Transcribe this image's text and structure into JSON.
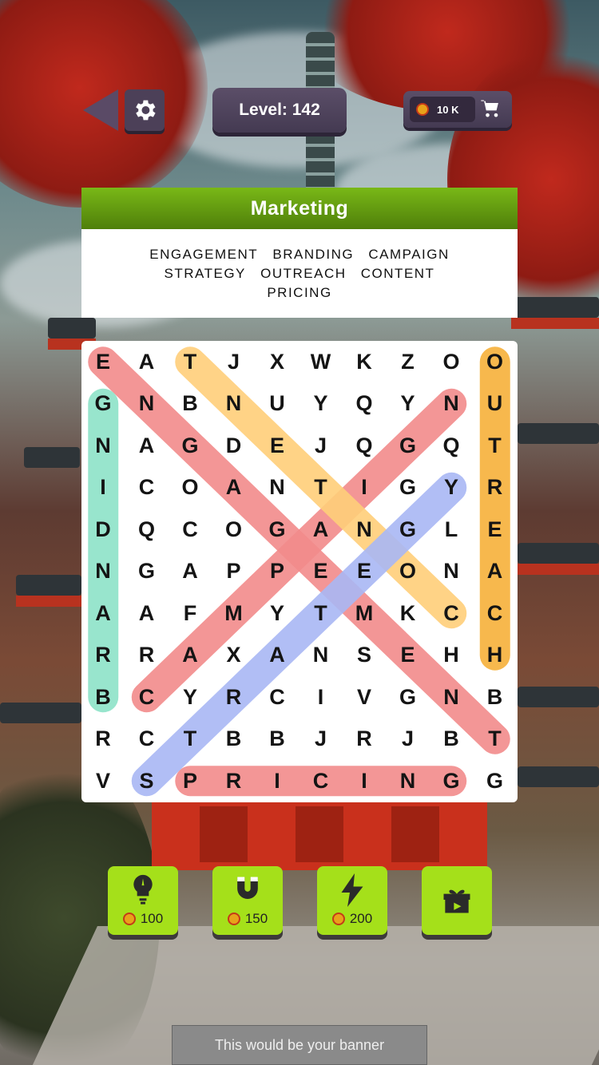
{
  "header": {
    "level_text": "Level: 142",
    "coins": "10 K"
  },
  "topic": {
    "title": "Marketing",
    "words": [
      "ENGAGEMENT",
      "BRANDING",
      "CAMPAIGN",
      "STRATEGY",
      "OUTREACH",
      "CONTENT",
      "PRICING"
    ]
  },
  "grid": {
    "rows": [
      [
        "E",
        "A",
        "T",
        "J",
        "X",
        "W",
        "K",
        "Z",
        "O",
        "O"
      ],
      [
        "G",
        "N",
        "B",
        "N",
        "U",
        "Y",
        "Q",
        "Y",
        "N",
        "U"
      ],
      [
        "N",
        "A",
        "G",
        "D",
        "E",
        "J",
        "Q",
        "G",
        "Q",
        "T"
      ],
      [
        "I",
        "C",
        "O",
        "A",
        "N",
        "T",
        "I",
        "G",
        "Y",
        "R"
      ],
      [
        "D",
        "Q",
        "C",
        "O",
        "G",
        "A",
        "N",
        "G",
        "L",
        "E"
      ],
      [
        "N",
        "G",
        "A",
        "P",
        "P",
        "E",
        "E",
        "O",
        "N",
        "A"
      ],
      [
        "A",
        "A",
        "F",
        "M",
        "Y",
        "T",
        "M",
        "K",
        "C",
        "C"
      ],
      [
        "R",
        "R",
        "A",
        "X",
        "A",
        "N",
        "S",
        "E",
        "H",
        "H"
      ],
      [
        "B",
        "C",
        "Y",
        "R",
        "C",
        "I",
        "V",
        "G",
        "N",
        "B"
      ],
      [
        "R",
        "C",
        "T",
        "B",
        "B",
        "J",
        "R",
        "J",
        "B",
        "T"
      ],
      [
        "V",
        "S",
        "P",
        "R",
        "I",
        "C",
        "I",
        "N",
        "G",
        "G"
      ]
    ],
    "found_words": [
      {
        "word": "ENGAGEMENT",
        "color": "#f28b8b"
      },
      {
        "word": "CAMPAIGN",
        "color": "#f28b8b"
      },
      {
        "word": "PRICING",
        "color": "#f28b8b"
      },
      {
        "word": "CONTENT",
        "color": "#ffcf7a"
      },
      {
        "word": "STRATEGY",
        "color": "#a9b8f5"
      },
      {
        "word": "BRANDING",
        "color": "#8de3c8"
      },
      {
        "word": "OUTREACH",
        "color": "#f7b13a"
      }
    ]
  },
  "boosters": [
    {
      "icon": "lightbulb-icon",
      "cost": "100"
    },
    {
      "icon": "magnet-icon",
      "cost": "150"
    },
    {
      "icon": "lightning-icon",
      "cost": "200"
    },
    {
      "icon": "gift-video-icon",
      "cost": ""
    }
  ],
  "banner": {
    "text": "This would be your banner"
  },
  "colors": {
    "topic_green": "#6aa612",
    "panel_purple": "#4c4058",
    "booster_green": "#a5e01a"
  }
}
